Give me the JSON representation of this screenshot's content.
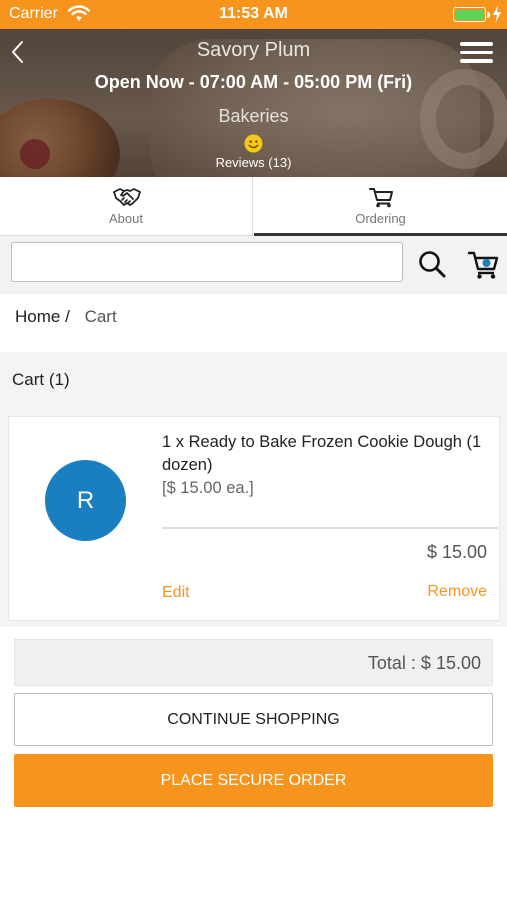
{
  "status_bar": {
    "carrier": "Carrier",
    "time": "11:53 AM",
    "battery_color": "#5ed35a"
  },
  "header": {
    "store_name": "Savory Plum",
    "hours": "Open Now - 07:00 AM - 05:00 PM (Fri)",
    "category": "Bakeries",
    "reviews": "Reviews (13)",
    "icons": {
      "back": "chevron-left-icon",
      "menu": "hamburger-menu-icon",
      "rating": "smiley-icon"
    }
  },
  "tabs": [
    {
      "label": "About",
      "icon": "handshake-icon",
      "active": false
    },
    {
      "label": "Ordering",
      "icon": "cart-icon",
      "active": true
    }
  ],
  "search": {
    "value": "",
    "placeholder": ""
  },
  "breadcrumb": {
    "home": "Home",
    "separator": "/",
    "current": "Cart"
  },
  "cart": {
    "title": "Cart (1)",
    "items": [
      {
        "avatar_letter": "R",
        "avatar_color": "#1a7fc1",
        "name": "1 x Ready to Bake Frozen Cookie Dough (1 dozen)",
        "unit_price": "[$ 15.00 ea.]",
        "line_total": "$ 15.00",
        "edit_label": "Edit",
        "remove_label": "Remove"
      }
    ],
    "total": "Total : $ 15.00",
    "continue_label": "CONTINUE SHOPPING",
    "order_label": "PLACE SECURE ORDER"
  },
  "colors": {
    "accent": "#f7941d",
    "text": "#222222",
    "muted": "#555555"
  }
}
